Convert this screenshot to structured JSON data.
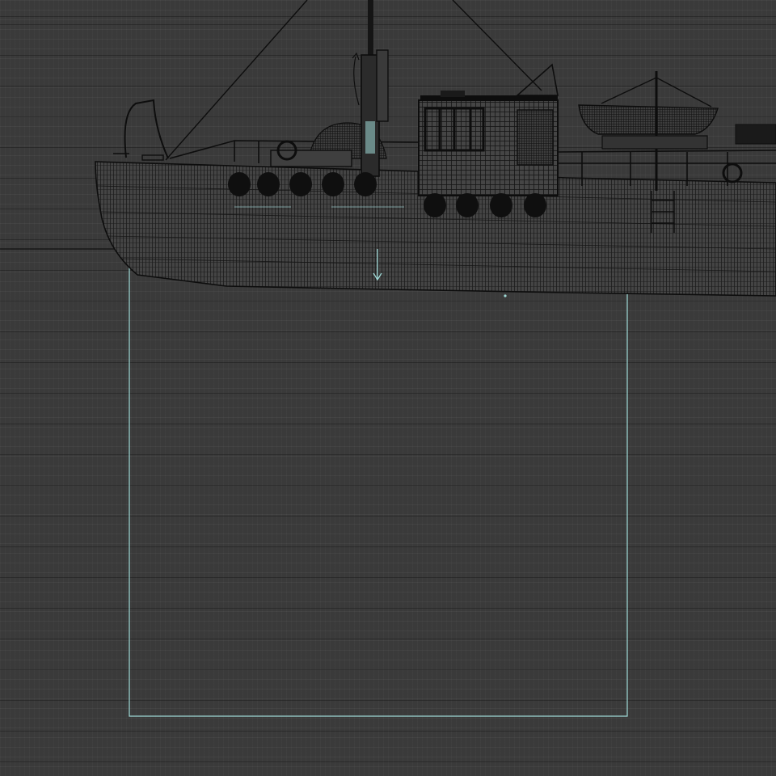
{
  "viewport": {
    "view": "side-orthographic-wireframe",
    "colors": {
      "background": "#3a3a3a",
      "wire": "#0d0d0d",
      "selection": "#9fd9d6",
      "horizon": "#111111"
    }
  },
  "scene": {
    "object": "ship-hull-wireframe",
    "selection": "selection-frame",
    "gizmo": "move-gizmo-arrow"
  }
}
